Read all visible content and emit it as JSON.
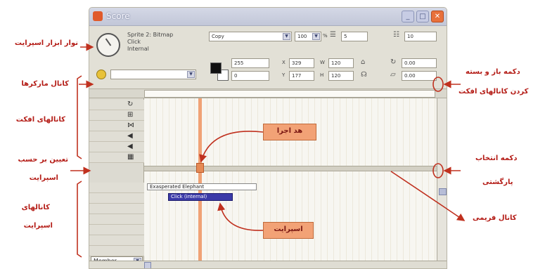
{
  "window": {
    "title": "Score"
  },
  "toolbar": {
    "sprite_line1": "Sprite 2: Bitmap",
    "sprite_line2": "Click",
    "sprite_line3": "Internal",
    "ink_value": "Copy",
    "blend_value": "100",
    "blend_unit": "%",
    "start_frame": "5",
    "end_frame": "10",
    "fg_value": "255",
    "bg_value": "0",
    "x_value": "329",
    "y_value": "177",
    "w_value": "120",
    "h_value": "120",
    "rotation_value": "0.00",
    "skew_value": "0.00",
    "label_x": "X",
    "label_y": "Y",
    "label_w": "W",
    "label_h": "H"
  },
  "left": {
    "member_select": "Member"
  },
  "sprites": {
    "bar1": "Exasperated Elephant",
    "bar2": "Click (internal)"
  },
  "annotations": {
    "sprite_toolbar": "نوار ابزار اسپرایت",
    "marker_channel": "کانال مارکرها",
    "effects_channels": "کانالهای افکت",
    "display_by": "تعیین بر حسب",
    "display_by2": "اسپرایت",
    "sprite_channels1": "کانالهای",
    "sprite_channels2": "اسپرایت",
    "open_close_button1": "دکمه باز و بسته",
    "open_close_button2": "کردن کانالهای افکت",
    "reverse_button1": "دکمه انتخاب",
    "reverse_button2": "پارگشتی",
    "frame_channel": "کانال فریمی",
    "playhead": "هد اجرا",
    "sprite": "اسپرایت"
  },
  "colors": {
    "accent": "#f2a276",
    "annotation_text": "#b41c16",
    "arrow": "#c0311f"
  },
  "icons": [
    "tempo-icon",
    "palette-icon",
    "transition-icon",
    "sound1-icon",
    "sound2-icon",
    "script-icon",
    "close-icon",
    "minimize-icon",
    "maximize-icon"
  ]
}
